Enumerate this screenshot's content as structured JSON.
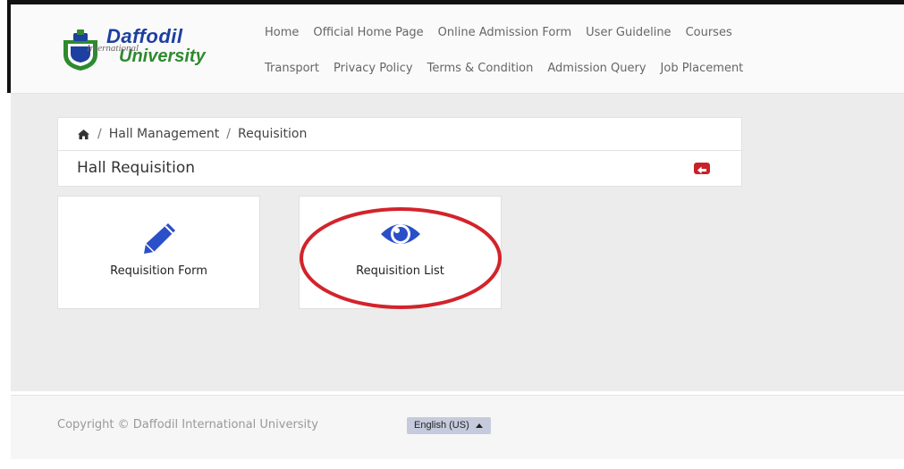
{
  "header": {
    "logo": {
      "line1": "Daffodil",
      "line2": "University",
      "middle": "International"
    },
    "nav_row1": [
      "Home",
      "Official Home Page",
      "Online Admission Form",
      "User Guideline",
      "Courses"
    ],
    "nav_row2": [
      "Transport",
      "Privacy Policy",
      "Terms & Condition",
      "Admission Query",
      "Job Placement"
    ]
  },
  "breadcrumb": {
    "items": [
      "Hall Management",
      "Requisition"
    ],
    "separator": "/"
  },
  "page": {
    "title": "Hall Requisition",
    "cards": [
      {
        "label": "Requisition Form",
        "icon": "pencil-icon"
      },
      {
        "label": "Requisition List",
        "icon": "eye-icon"
      }
    ]
  },
  "footer": {
    "copyright": "Copyright © Daffodil International University",
    "language": "English (US)"
  },
  "colors": {
    "brand_blue": "#1d3fa0",
    "brand_green": "#2e8a2e",
    "icon_blue": "#2b4fc8",
    "back_red": "#c8212a",
    "highlight_red": "#d3232b"
  }
}
